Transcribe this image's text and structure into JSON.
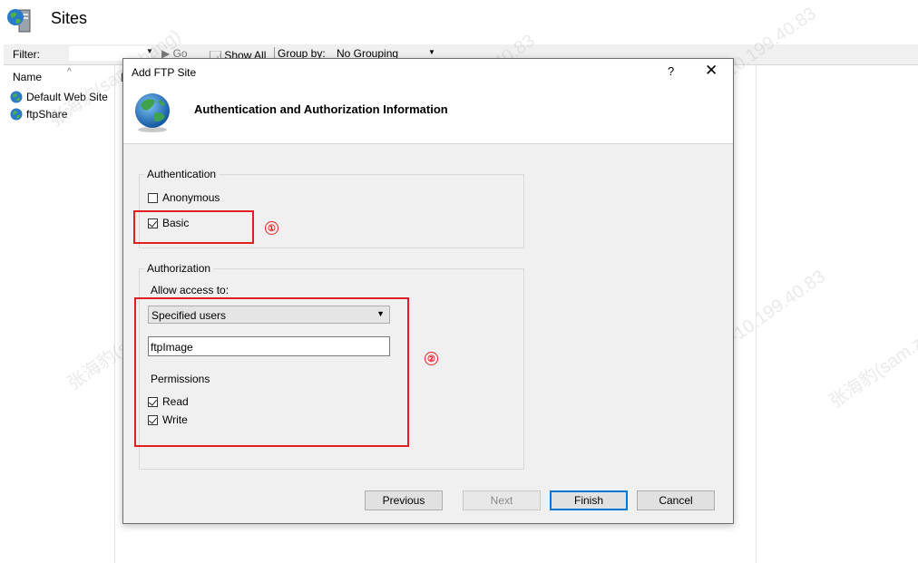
{
  "window": {
    "title": "Sites",
    "icon": "server-globe-icon"
  },
  "filter_bar": {
    "filter_label": "Filter:",
    "go_label": "Go",
    "show_all_label": "Show All",
    "group_by_label": "Group by:",
    "group_by_value": "No Grouping"
  },
  "sites_list": {
    "column_name": "Name",
    "items": [
      {
        "label": "Default Web Site",
        "icon": "globe-icon"
      },
      {
        "label": "ftpShare",
        "icon": "globe-icon"
      }
    ]
  },
  "dialog": {
    "title": "Add FTP Site",
    "help_glyph": "?",
    "close_glyph": "✕",
    "heading": "Authentication and Authorization Information",
    "authentication": {
      "group_title": "Authentication",
      "anonymous_label": "Anonymous",
      "anonymous_checked": false,
      "basic_label": "Basic",
      "basic_checked": true
    },
    "authorization": {
      "group_title": "Authorization",
      "allow_access_label": "Allow access to:",
      "allow_access_value": "Specified users",
      "users_value": "ftpImage",
      "permissions_label": "Permissions",
      "read_label": "Read",
      "read_checked": true,
      "write_label": "Write",
      "write_checked": true
    },
    "annotations": {
      "marker_1": "①",
      "marker_2": "②",
      "color": "#e02020"
    },
    "buttons": {
      "previous": "Previous",
      "next": "Next",
      "finish": "Finish",
      "cancel": "Cancel"
    }
  },
  "watermark": {
    "line_1": "张海豹(sam.zhang)",
    "line_2": "SOCSWZNZZ01-10.199.40.83"
  }
}
